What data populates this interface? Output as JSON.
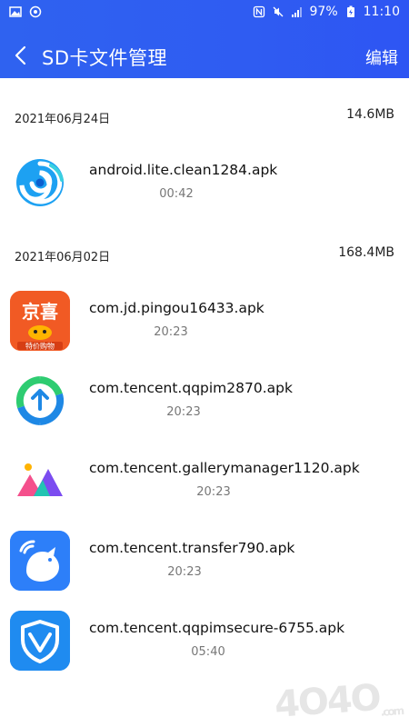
{
  "status_bar": {
    "battery": "97%",
    "time": "11:10"
  },
  "nav": {
    "title": "SD卡文件管理",
    "edit_label": "编辑"
  },
  "groups": [
    {
      "date": "2021年06月24日",
      "size": "14.6MB",
      "items": [
        {
          "name": "android.lite.clean1284.apk",
          "time": "00:42",
          "icon": "swirl-app-icon"
        }
      ]
    },
    {
      "date": "2021年06月02日",
      "size": "168.4MB",
      "items": [
        {
          "name": "com.jd.pingou16433.apk",
          "time": "20:23",
          "icon": "jingxi-app-icon",
          "icon_text_top": "京喜",
          "icon_text_bottom": "特价购物"
        },
        {
          "name": "com.tencent.qqpim2870.apk",
          "time": "20:23",
          "icon": "sync-app-icon"
        },
        {
          "name": "com.tencent.gallerymanager1120.apk",
          "time": "20:23",
          "icon": "gallery-app-icon"
        },
        {
          "name": "com.tencent.transfer790.apk",
          "time": "20:23",
          "icon": "bird-app-icon"
        },
        {
          "name": "com.tencent.qqpimsecure-6755.apk",
          "time": "05:40",
          "icon": "shield-app-icon"
        }
      ]
    }
  ],
  "watermark": {
    "main": "4O4O",
    "sub": ".com"
  },
  "colors": {
    "header": "#2f5cf2",
    "jingxi": "#f15a24",
    "sync_blue": "#1e88e5",
    "sync_green": "#2ecc71",
    "bird_blue": "#2d7ff9",
    "shield_blue": "#1f8bf0"
  }
}
